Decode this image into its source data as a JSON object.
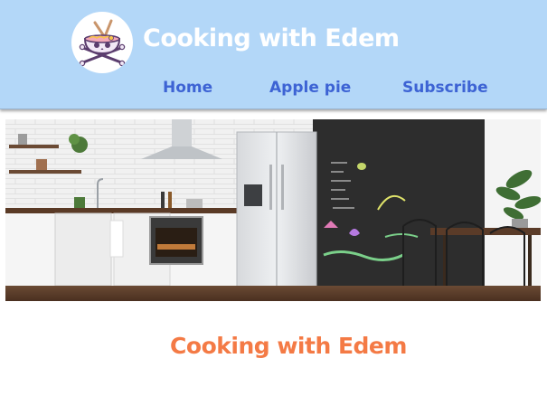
{
  "header": {
    "site_title": "Cooking with Edem",
    "logo_icon": "ramen-skull-logo-icon",
    "background": "#b3d7f8"
  },
  "nav": {
    "items": [
      {
        "label": "Home"
      },
      {
        "label": "Apple pie"
      },
      {
        "label": "Subscribe"
      }
    ],
    "link_color": "#3d63d4"
  },
  "hero": {
    "image": "modern-kitchen-photo"
  },
  "main": {
    "heading": "Cooking with Edem",
    "heading_color": "#f47a45"
  }
}
